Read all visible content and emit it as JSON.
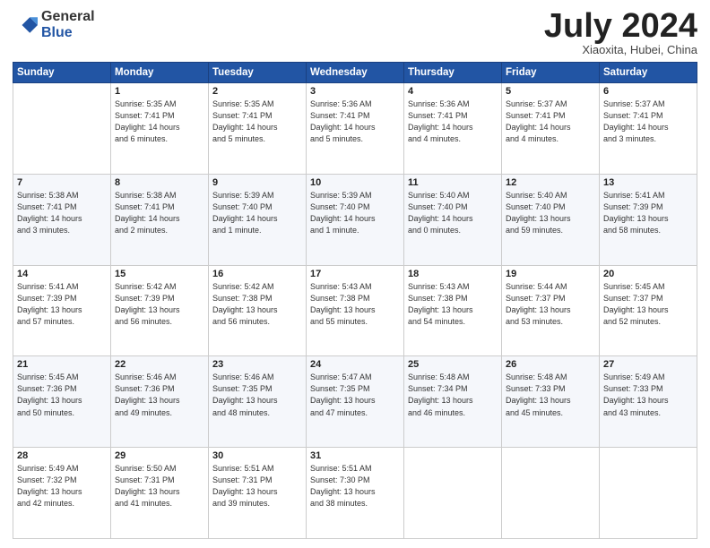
{
  "logo": {
    "general": "General",
    "blue": "Blue"
  },
  "header": {
    "month": "July 2024",
    "location": "Xiaoxita, Hubei, China"
  },
  "weekdays": [
    "Sunday",
    "Monday",
    "Tuesday",
    "Wednesday",
    "Thursday",
    "Friday",
    "Saturday"
  ],
  "weeks": [
    [
      {
        "day": "",
        "info": ""
      },
      {
        "day": "1",
        "info": "Sunrise: 5:35 AM\nSunset: 7:41 PM\nDaylight: 14 hours\nand 6 minutes."
      },
      {
        "day": "2",
        "info": "Sunrise: 5:35 AM\nSunset: 7:41 PM\nDaylight: 14 hours\nand 5 minutes."
      },
      {
        "day": "3",
        "info": "Sunrise: 5:36 AM\nSunset: 7:41 PM\nDaylight: 14 hours\nand 5 minutes."
      },
      {
        "day": "4",
        "info": "Sunrise: 5:36 AM\nSunset: 7:41 PM\nDaylight: 14 hours\nand 4 minutes."
      },
      {
        "day": "5",
        "info": "Sunrise: 5:37 AM\nSunset: 7:41 PM\nDaylight: 14 hours\nand 4 minutes."
      },
      {
        "day": "6",
        "info": "Sunrise: 5:37 AM\nSunset: 7:41 PM\nDaylight: 14 hours\nand 3 minutes."
      }
    ],
    [
      {
        "day": "7",
        "info": "Sunrise: 5:38 AM\nSunset: 7:41 PM\nDaylight: 14 hours\nand 3 minutes."
      },
      {
        "day": "8",
        "info": "Sunrise: 5:38 AM\nSunset: 7:41 PM\nDaylight: 14 hours\nand 2 minutes."
      },
      {
        "day": "9",
        "info": "Sunrise: 5:39 AM\nSunset: 7:40 PM\nDaylight: 14 hours\nand 1 minute."
      },
      {
        "day": "10",
        "info": "Sunrise: 5:39 AM\nSunset: 7:40 PM\nDaylight: 14 hours\nand 1 minute."
      },
      {
        "day": "11",
        "info": "Sunrise: 5:40 AM\nSunset: 7:40 PM\nDaylight: 14 hours\nand 0 minutes."
      },
      {
        "day": "12",
        "info": "Sunrise: 5:40 AM\nSunset: 7:40 PM\nDaylight: 13 hours\nand 59 minutes."
      },
      {
        "day": "13",
        "info": "Sunrise: 5:41 AM\nSunset: 7:39 PM\nDaylight: 13 hours\nand 58 minutes."
      }
    ],
    [
      {
        "day": "14",
        "info": "Sunrise: 5:41 AM\nSunset: 7:39 PM\nDaylight: 13 hours\nand 57 minutes."
      },
      {
        "day": "15",
        "info": "Sunrise: 5:42 AM\nSunset: 7:39 PM\nDaylight: 13 hours\nand 56 minutes."
      },
      {
        "day": "16",
        "info": "Sunrise: 5:42 AM\nSunset: 7:38 PM\nDaylight: 13 hours\nand 56 minutes."
      },
      {
        "day": "17",
        "info": "Sunrise: 5:43 AM\nSunset: 7:38 PM\nDaylight: 13 hours\nand 55 minutes."
      },
      {
        "day": "18",
        "info": "Sunrise: 5:43 AM\nSunset: 7:38 PM\nDaylight: 13 hours\nand 54 minutes."
      },
      {
        "day": "19",
        "info": "Sunrise: 5:44 AM\nSunset: 7:37 PM\nDaylight: 13 hours\nand 53 minutes."
      },
      {
        "day": "20",
        "info": "Sunrise: 5:45 AM\nSunset: 7:37 PM\nDaylight: 13 hours\nand 52 minutes."
      }
    ],
    [
      {
        "day": "21",
        "info": "Sunrise: 5:45 AM\nSunset: 7:36 PM\nDaylight: 13 hours\nand 50 minutes."
      },
      {
        "day": "22",
        "info": "Sunrise: 5:46 AM\nSunset: 7:36 PM\nDaylight: 13 hours\nand 49 minutes."
      },
      {
        "day": "23",
        "info": "Sunrise: 5:46 AM\nSunset: 7:35 PM\nDaylight: 13 hours\nand 48 minutes."
      },
      {
        "day": "24",
        "info": "Sunrise: 5:47 AM\nSunset: 7:35 PM\nDaylight: 13 hours\nand 47 minutes."
      },
      {
        "day": "25",
        "info": "Sunrise: 5:48 AM\nSunset: 7:34 PM\nDaylight: 13 hours\nand 46 minutes."
      },
      {
        "day": "26",
        "info": "Sunrise: 5:48 AM\nSunset: 7:33 PM\nDaylight: 13 hours\nand 45 minutes."
      },
      {
        "day": "27",
        "info": "Sunrise: 5:49 AM\nSunset: 7:33 PM\nDaylight: 13 hours\nand 43 minutes."
      }
    ],
    [
      {
        "day": "28",
        "info": "Sunrise: 5:49 AM\nSunset: 7:32 PM\nDaylight: 13 hours\nand 42 minutes."
      },
      {
        "day": "29",
        "info": "Sunrise: 5:50 AM\nSunset: 7:31 PM\nDaylight: 13 hours\nand 41 minutes."
      },
      {
        "day": "30",
        "info": "Sunrise: 5:51 AM\nSunset: 7:31 PM\nDaylight: 13 hours\nand 39 minutes."
      },
      {
        "day": "31",
        "info": "Sunrise: 5:51 AM\nSunset: 7:30 PM\nDaylight: 13 hours\nand 38 minutes."
      },
      {
        "day": "",
        "info": ""
      },
      {
        "day": "",
        "info": ""
      },
      {
        "day": "",
        "info": ""
      }
    ]
  ]
}
